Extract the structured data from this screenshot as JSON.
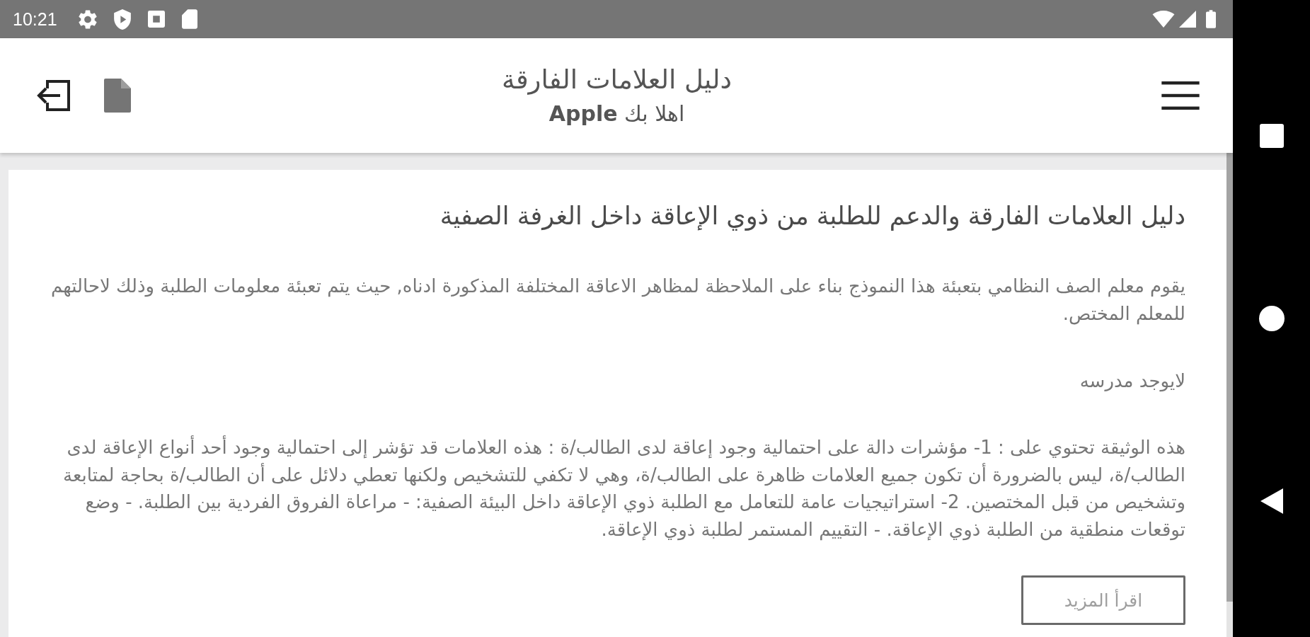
{
  "status_bar": {
    "time": "10:21"
  },
  "app_bar": {
    "title": "دليل العلامات الفارقة",
    "subtitle": "اهلا بك **Apple**"
  },
  "card": {
    "title": "دليل العلامات الفارقة والدعم للطلبة من ذوي الإعاقة داخل الغرفة الصفية",
    "intro": "يقوم معلم الصف النظامي بتعبئة هذا النموذج بناء على الملاحظة لمظاهر الاعاقة المختلفة المذكورة ادناه, حيث يتم تعبئة معلومات الطلبة وذلك لاحالتهم للمعلم المختص.",
    "school_note": "لايوجد مدرسه",
    "description": "هذه الوثيقة تحتوي على : 1- مؤشرات دالة على احتمالية وجود إعاقة لدى الطالب/ة : هذه العلامات قد تؤشر إلى احتمالية وجود أحد أنواع الإعاقة لدى الطالب/ة، ليس بالضرورة أن تكون جميع العلامات ظاهرة على الطالب/ة، وهي لا تكفي للتشخيص ولكنها تعطي دلائل على أن الطالب/ة بحاجة لمتابعة وتشخيص من قبل المختصين. 2- استراتيجيات عامة للتعامل مع الطلبة ذوي الإعاقة داخل البيئة الصفية: - مراعاة الفروق الفردية بين الطلبة. - وضع توقعات منطقية من الطلبة ذوي الإعاقة. - التقييم المستمر لطلبة ذوي الإعاقة.",
    "read_more_button": "اقرأ المزيد"
  }
}
